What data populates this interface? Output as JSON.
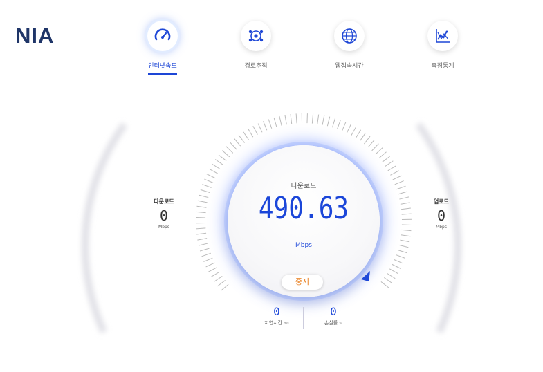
{
  "logo": "NIA",
  "tabs": [
    {
      "label": "인터넷속도",
      "icon": "speedometer-icon"
    },
    {
      "label": "경로추적",
      "icon": "route-trace-icon"
    },
    {
      "label": "웹접속시간",
      "icon": "globe-icon"
    },
    {
      "label": "측정통계",
      "icon": "statistics-chart-icon"
    }
  ],
  "download": {
    "title": "다운로드",
    "value": "0",
    "unit": "Mbps"
  },
  "upload": {
    "title": "업로드",
    "value": "0",
    "unit": "Mbps"
  },
  "gauge": {
    "label": "다운로드",
    "speed": "490.63",
    "unit": "Mbps",
    "stop_label": "중지"
  },
  "latency": {
    "value": "0",
    "label": "지연시간",
    "unit": "ms"
  },
  "loss": {
    "value": "0",
    "label": "손실률",
    "unit": "%"
  },
  "colors": {
    "accent": "#1b46d9",
    "stop": "#e87a16",
    "logo": "#1f3568"
  }
}
